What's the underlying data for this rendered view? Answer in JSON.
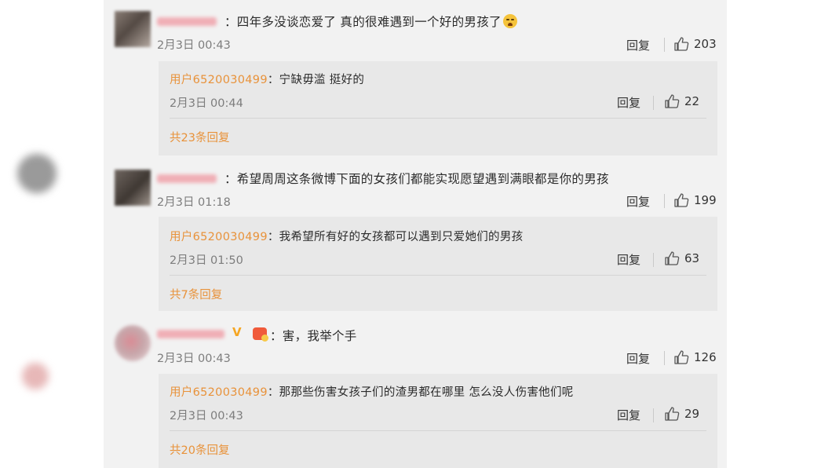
{
  "comments": [
    {
      "text": "：四年多没谈恋爱了 真的很难遇到一个好的男孩了",
      "emoji": "crying-face-icon",
      "time": "2月3日 00:43",
      "reply_label": "回复",
      "likes": "203",
      "sub": {
        "user": "用户6520030499",
        "text": "：宁缺毋滥 挺好的",
        "time": "2月3日 00:44",
        "reply_label": "回复",
        "likes": "22",
        "more": "共23条回复"
      }
    },
    {
      "text": "：希望周周这条微博下面的女孩们都能实现愿望遇到满眼都是你的男孩",
      "time": "2月3日 01:18",
      "reply_label": "回复",
      "likes": "199",
      "sub": {
        "user": "用户6520030499",
        "text": "：我希望所有好的女孩都可以遇到只爱她们的男孩",
        "time": "2月3日 01:50",
        "reply_label": "回复",
        "likes": "63",
        "more": "共7条回复"
      }
    },
    {
      "text": "：害，我举个手",
      "badge": "V",
      "time": "2月3日 00:43",
      "reply_label": "回复",
      "likes": "126",
      "sub": {
        "user": "用户6520030499",
        "text": "：那那些伤害女孩子们的渣男都在哪里 怎么没人伤害他们呢",
        "time": "2月3日 00:43",
        "reply_label": "回复",
        "likes": "29",
        "more": "共20条回复"
      }
    }
  ],
  "colors": {
    "panel_bg": "#f2f2f2",
    "sub_bg": "#e8e8e8",
    "link": "#e8923a",
    "vip": "#f5a623"
  }
}
